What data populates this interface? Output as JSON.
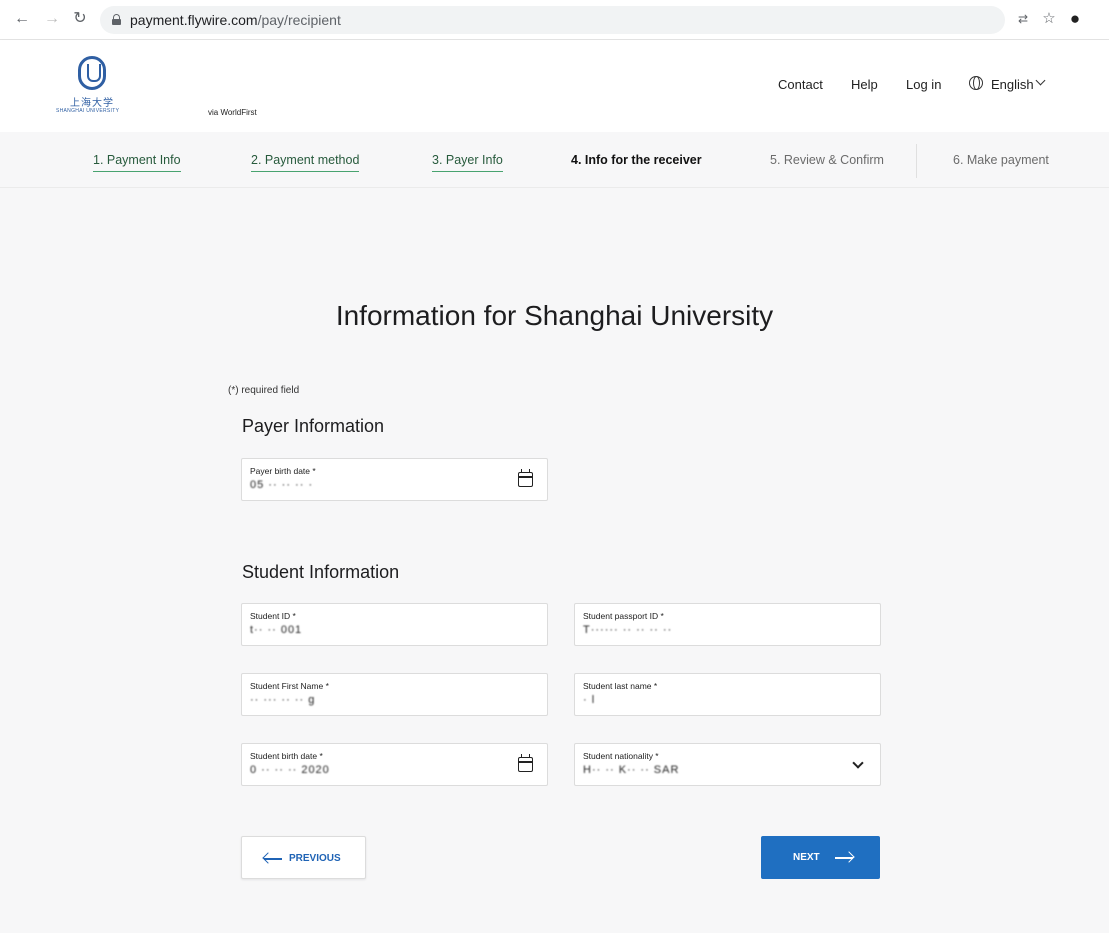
{
  "browser": {
    "url_host": "payment.flywire.com",
    "url_path": "/pay/recipient"
  },
  "header": {
    "logo_text_cn": "上海大学",
    "logo_text_en": "SHANGHAI UNIVERSITY",
    "via": "via WorldFirst",
    "links": {
      "contact": "Contact",
      "help": "Help",
      "login": "Log in"
    },
    "language": "English"
  },
  "steps": [
    {
      "label": "1. Payment Info",
      "state": "done"
    },
    {
      "label": "2. Payment method",
      "state": "done"
    },
    {
      "label": "3. Payer Info",
      "state": "done"
    },
    {
      "label": "4. Info for the receiver",
      "state": "active"
    },
    {
      "label": "5. Review & Confirm",
      "state": "todo"
    },
    {
      "label": "6. Make payment",
      "state": "todo"
    }
  ],
  "main": {
    "title": "Information for Shanghai University",
    "required_note": "(*) required field",
    "payer_section": "Payer Information",
    "student_section": "Student Information"
  },
  "fields": {
    "payer_birth_date": {
      "label": "Payer birth date *",
      "value": "05 ·· ·· ·· ·"
    },
    "student_id": {
      "label": "Student ID *",
      "value": "t·· ·· 001"
    },
    "student_passport_id": {
      "label": "Student passport ID *",
      "value": "T······ ·· ·· ·· ··"
    },
    "student_first_name": {
      "label": "Student First Name *",
      "value": "·· ··· ·· ·· g"
    },
    "student_last_name": {
      "label": "Student last name *",
      "value": "· l"
    },
    "student_birth_date": {
      "label": "Student birth date *",
      "value": "0 ·· ·· ·· 2020"
    },
    "student_nationality": {
      "label": "Student nationality *",
      "value": "H·· ·· K·· ·· SAR"
    }
  },
  "buttons": {
    "previous": "PREVIOUS",
    "next": "NEXT"
  },
  "colors": {
    "primary": "#1f6fc1",
    "step_done": "#48a36f"
  }
}
